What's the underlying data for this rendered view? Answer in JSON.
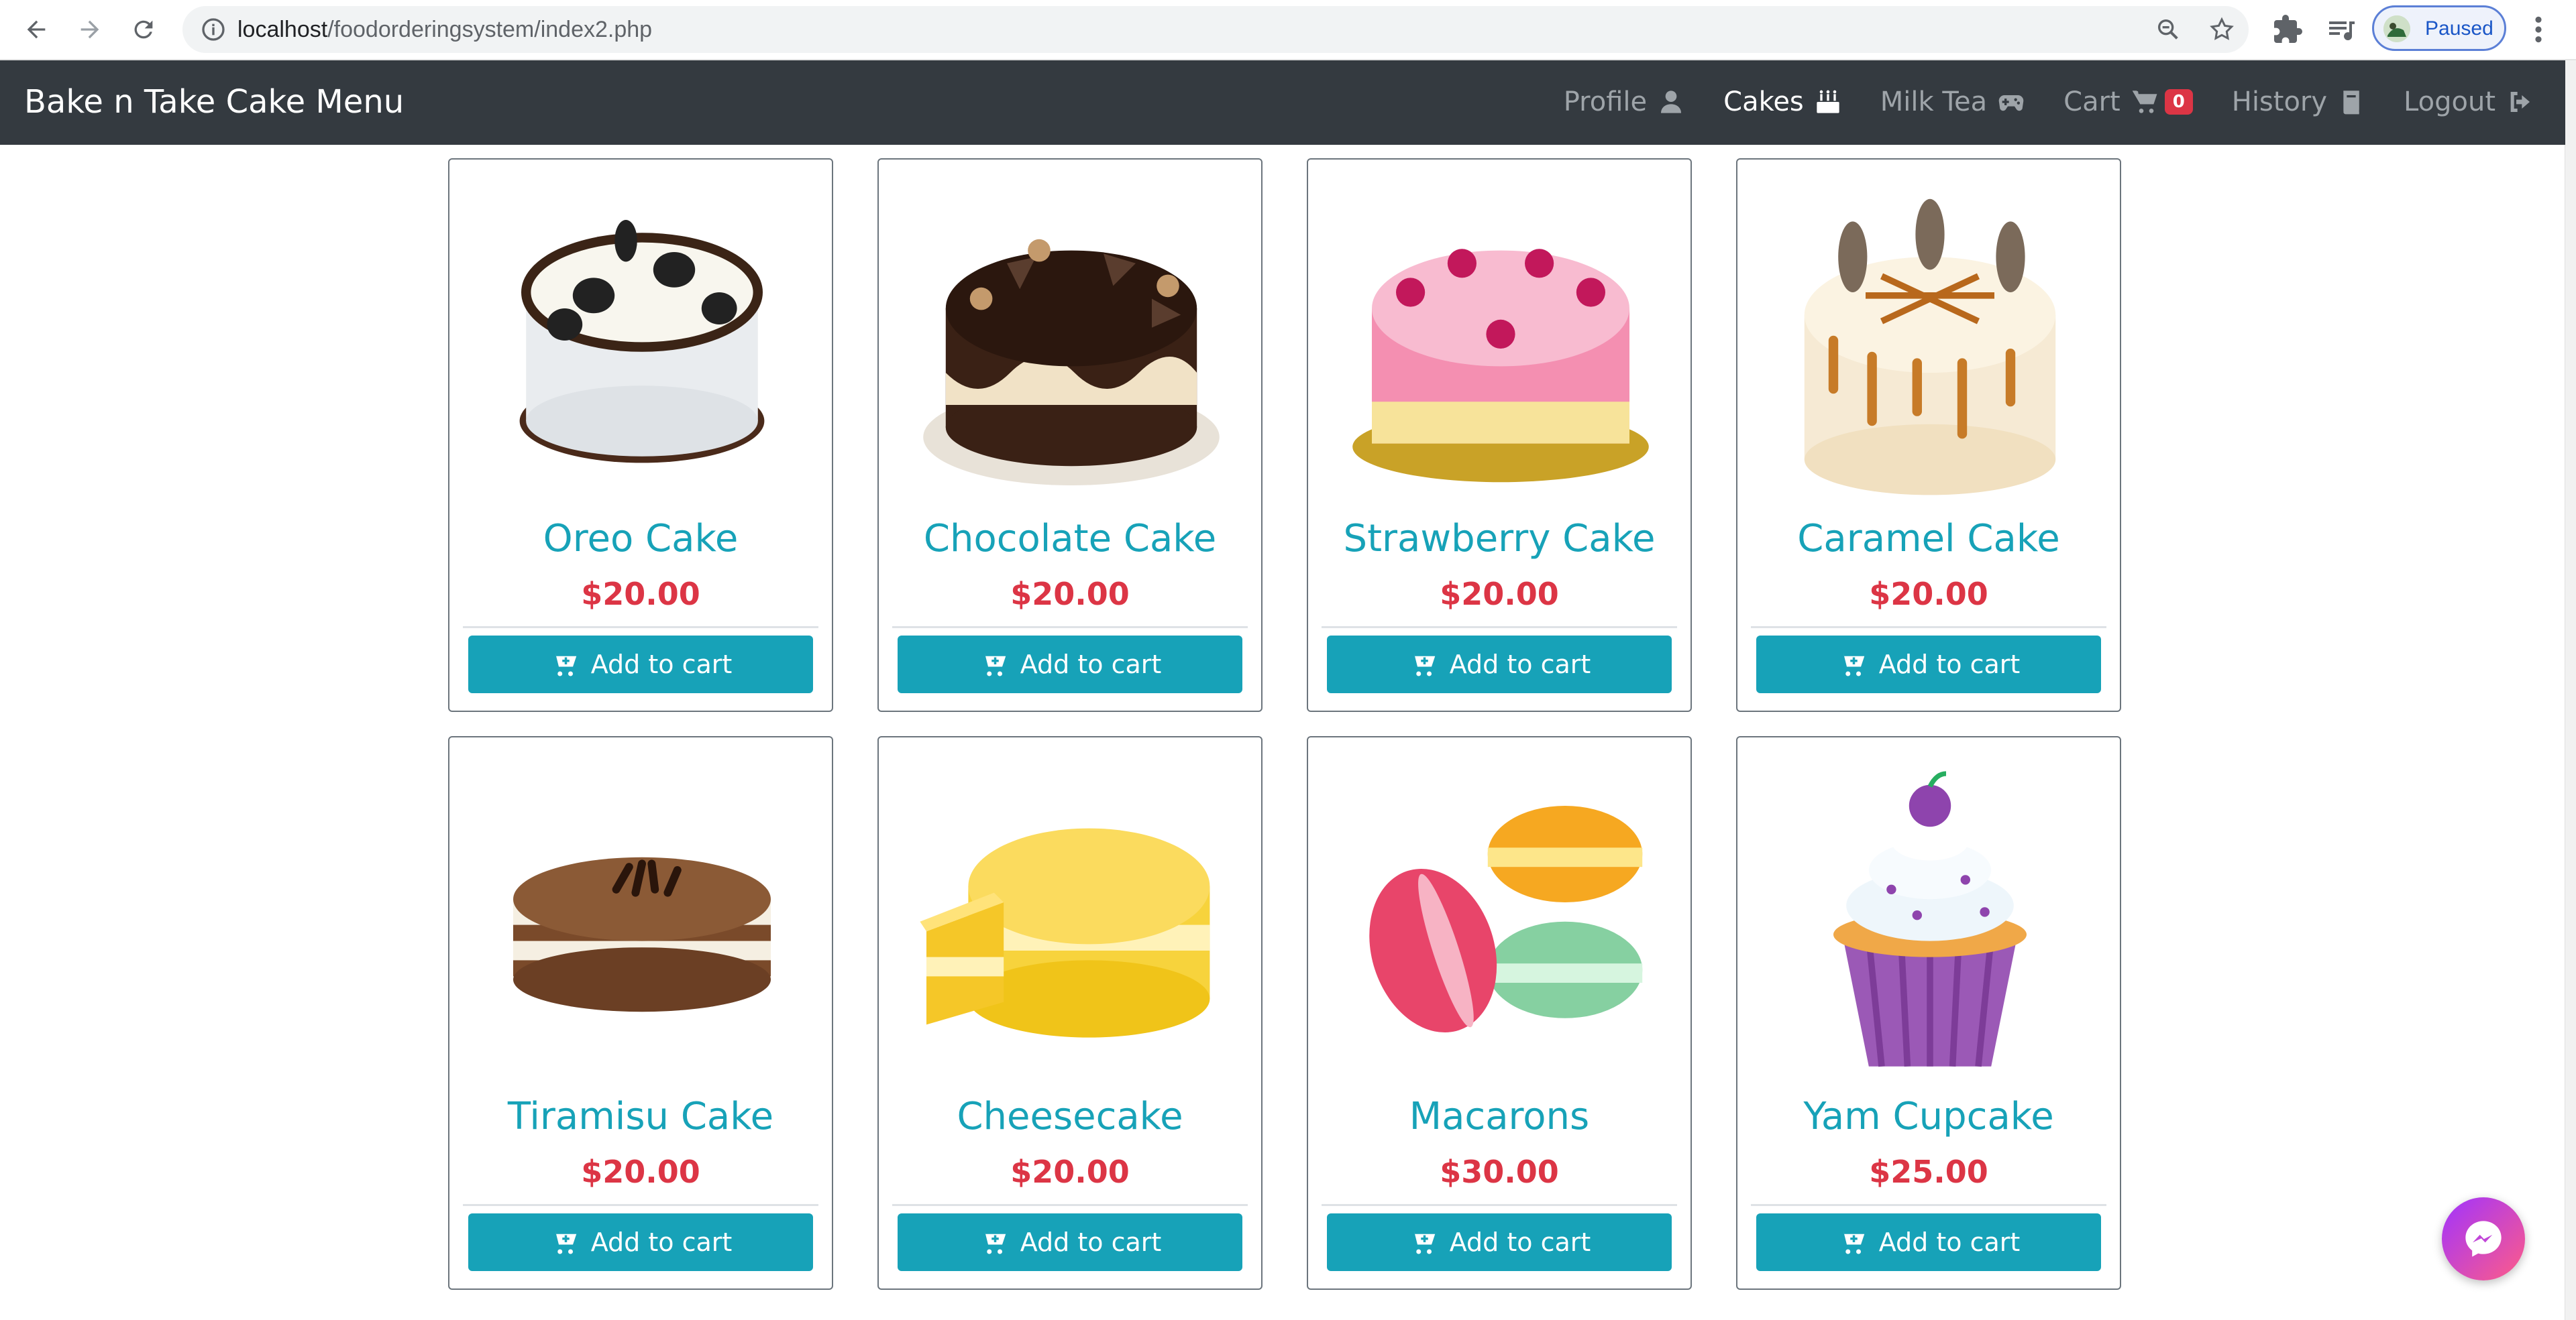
{
  "browser": {
    "url_host": "localhost",
    "url_path": "/foodorderingsystem/index2.php",
    "profile_label": "Paused"
  },
  "navbar": {
    "brand": "Bake n Take Cake Menu",
    "links": [
      {
        "label": "Profile",
        "icon": "user-icon"
      },
      {
        "label": "Cakes",
        "icon": "birthday-cake-icon",
        "active": true
      },
      {
        "label": "Milk Tea",
        "icon": "gamepad-icon"
      },
      {
        "label": "Cart",
        "icon": "shopping-cart-icon",
        "badge": "0"
      },
      {
        "label": "History",
        "icon": "book-icon"
      },
      {
        "label": "Logout",
        "icon": "sign-out-icon"
      }
    ]
  },
  "products": [
    {
      "name": "Oreo Cake",
      "price": "$20.00",
      "button": "Add to cart"
    },
    {
      "name": "Chocolate Cake",
      "price": "$20.00",
      "button": "Add to cart"
    },
    {
      "name": "Strawberry Cake",
      "price": "$20.00",
      "button": "Add to cart"
    },
    {
      "name": "Caramel Cake",
      "price": "$20.00",
      "button": "Add to cart"
    },
    {
      "name": "Tiramisu Cake",
      "price": "$20.00",
      "button": "Add to cart"
    },
    {
      "name": "Cheesecake",
      "price": "$20.00",
      "button": "Add to cart"
    },
    {
      "name": "Macarons",
      "price": "$30.00",
      "button": "Add to cart"
    },
    {
      "name": "Yam Cupcake",
      "price": "$25.00",
      "button": "Add to cart"
    }
  ],
  "colors": {
    "navbar_bg": "#343a40",
    "accent": "#17a2b8",
    "price": "#dc3545"
  }
}
